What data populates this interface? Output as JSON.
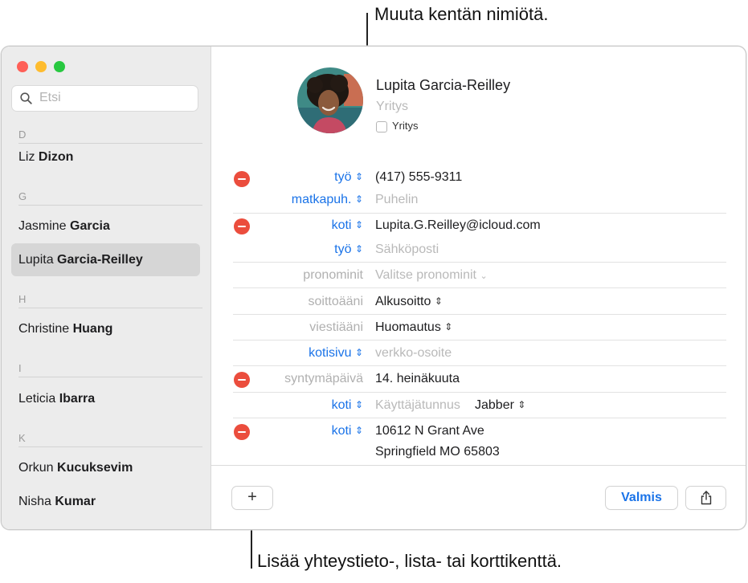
{
  "callouts": {
    "top": "Muuta kentän nimiötä.",
    "bottom": "Lisää yhteystieto-, lista- tai korttikenttä."
  },
  "colors": {
    "accent": "#1a73e8",
    "remove": "#eb4d3d",
    "close": "#ff5f57",
    "minimize": "#febc2e",
    "zoom": "#28c840"
  },
  "sidebar": {
    "search_placeholder": "Etsi",
    "sections": [
      {
        "letter": "D",
        "contacts": [
          {
            "first": "Liz",
            "last": "Dizon"
          }
        ]
      },
      {
        "letter": "G",
        "contacts": [
          {
            "first": "Jasmine",
            "last": "Garcia"
          },
          {
            "first": "Lupita",
            "last": "Garcia-Reilley"
          }
        ]
      },
      {
        "letter": "H",
        "contacts": [
          {
            "first": "Christine",
            "last": "Huang"
          }
        ]
      },
      {
        "letter": "I",
        "contacts": [
          {
            "first": "Leticia",
            "last": "Ibarra"
          }
        ]
      },
      {
        "letter": "K",
        "contacts": [
          {
            "first": "Orkun",
            "last": "Kucuksevim"
          },
          {
            "first": "Nisha",
            "last": "Kumar"
          }
        ]
      }
    ]
  },
  "card": {
    "name": "Lupita  Garcia-Reilley",
    "company_placeholder": "Yritys",
    "company_checkbox_label": "Yritys",
    "fields": {
      "phone1": {
        "label": "työ",
        "value": "(417) 555-9311"
      },
      "phone2": {
        "label": "matkapuh.",
        "placeholder": "Puhelin"
      },
      "email1": {
        "label": "koti",
        "value": "Lupita.G.Reilley@icloud.com"
      },
      "email2": {
        "label": "työ",
        "placeholder": "Sähköposti"
      },
      "pronouns": {
        "label": "pronominit",
        "placeholder": "Valitse pronominit"
      },
      "ringtone": {
        "label": "soittoääni",
        "value": "Alkusoitto"
      },
      "texttone": {
        "label": "viestiääni",
        "value": "Huomautus"
      },
      "homepage": {
        "label": "kotisivu",
        "placeholder": "verkko-osoite"
      },
      "birthday": {
        "label": "syntymäpäivä",
        "value": "14. heinäkuuta"
      },
      "im": {
        "label": "koti",
        "placeholder": "Käyttäjätunnus",
        "service": "Jabber"
      },
      "address": {
        "label": "koti",
        "line1": "10612 N Grant Ave",
        "line2": "Springfield MO 65803"
      }
    }
  },
  "footer": {
    "add_label": "+",
    "done_label": "Valmis",
    "share_icon": "share-icon"
  }
}
